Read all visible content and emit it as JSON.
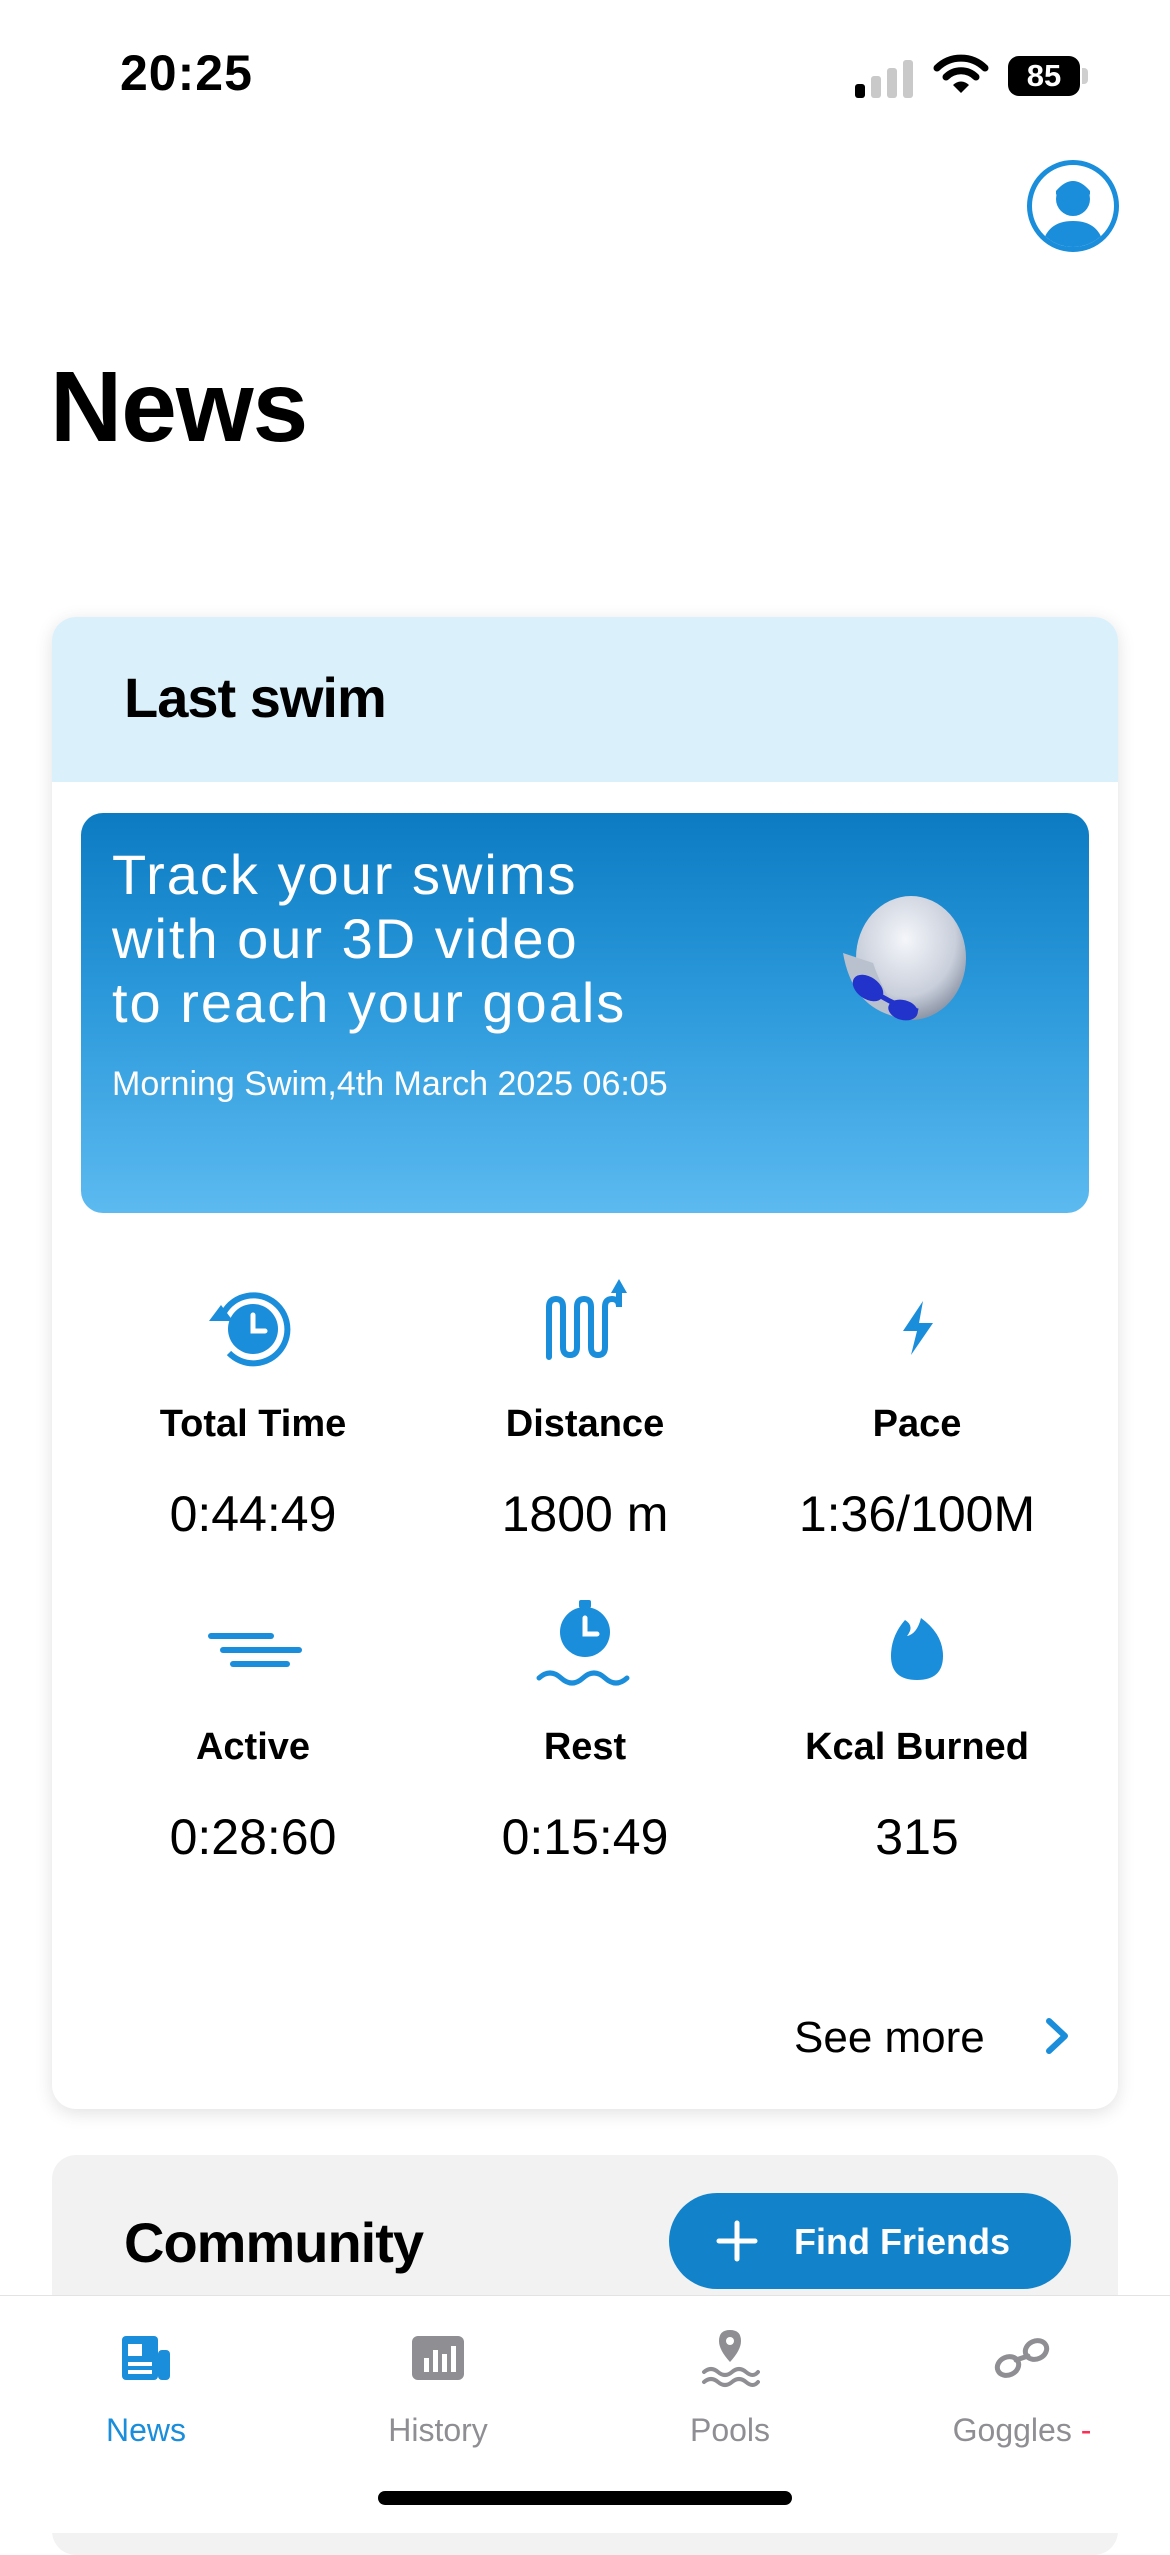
{
  "status_bar": {
    "time": "20:25",
    "battery": "85"
  },
  "header": {
    "title": "News"
  },
  "last_swim": {
    "title": "Last swim",
    "banner": {
      "lines": [
        "Track your swims",
        "with our 3D video",
        "to reach your goals"
      ],
      "subtitle": "Morning Swim,4th March 2025 06:05"
    },
    "stats": [
      {
        "label": "Total Time",
        "value": "0:44:49",
        "icon": "timer-history-icon"
      },
      {
        "label": "Distance",
        "value": "1800 m",
        "icon": "lap-distance-icon"
      },
      {
        "label": "Pace",
        "value": "1:36/100M",
        "icon": "lightning-icon"
      },
      {
        "label": "Active",
        "value": "0:28:60",
        "icon": "speed-lines-icon"
      },
      {
        "label": "Rest",
        "value": "0:15:49",
        "icon": "stopwatch-water-icon"
      },
      {
        "label": "Kcal Burned",
        "value": "315",
        "icon": "flame-icon"
      }
    ],
    "see_more": "See more"
  },
  "community": {
    "title": "Community",
    "find_friends": "Find Friends"
  },
  "nav": {
    "items": [
      {
        "label": "News",
        "icon": "news-icon",
        "active": true
      },
      {
        "label": "History",
        "icon": "bar-chart-icon",
        "active": false
      },
      {
        "label": "Pools",
        "icon": "pool-location-icon",
        "active": false
      },
      {
        "label": "Goggles",
        "icon": "goggles-icon",
        "active": false,
        "suffix": "-"
      }
    ]
  },
  "colors": {
    "accent": "#1a8ddb",
    "header_bg": "#daf0fb",
    "button": "#1283cb",
    "inactive": "#8e8e93"
  }
}
